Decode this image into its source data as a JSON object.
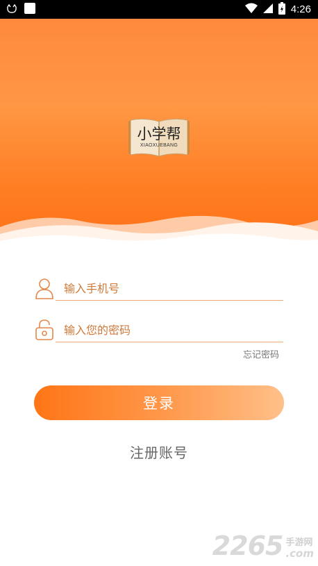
{
  "status_bar": {
    "time": "4:26"
  },
  "logo": {
    "title": "小学帮",
    "subtitle": "XIAOXUEBANG"
  },
  "login_form": {
    "phone_placeholder": "输入手机号",
    "password_placeholder": "输入您的密码",
    "forgot_password": "忘记密码",
    "login_button": "登录",
    "register_link": "注册账号"
  },
  "watermark": {
    "number": "2265",
    "site_cn": "手游网",
    "site_com": ".com"
  },
  "colors": {
    "brand_orange": "#ff7a1f",
    "placeholder": "#cf7a3a",
    "underline": "#f3a770"
  }
}
